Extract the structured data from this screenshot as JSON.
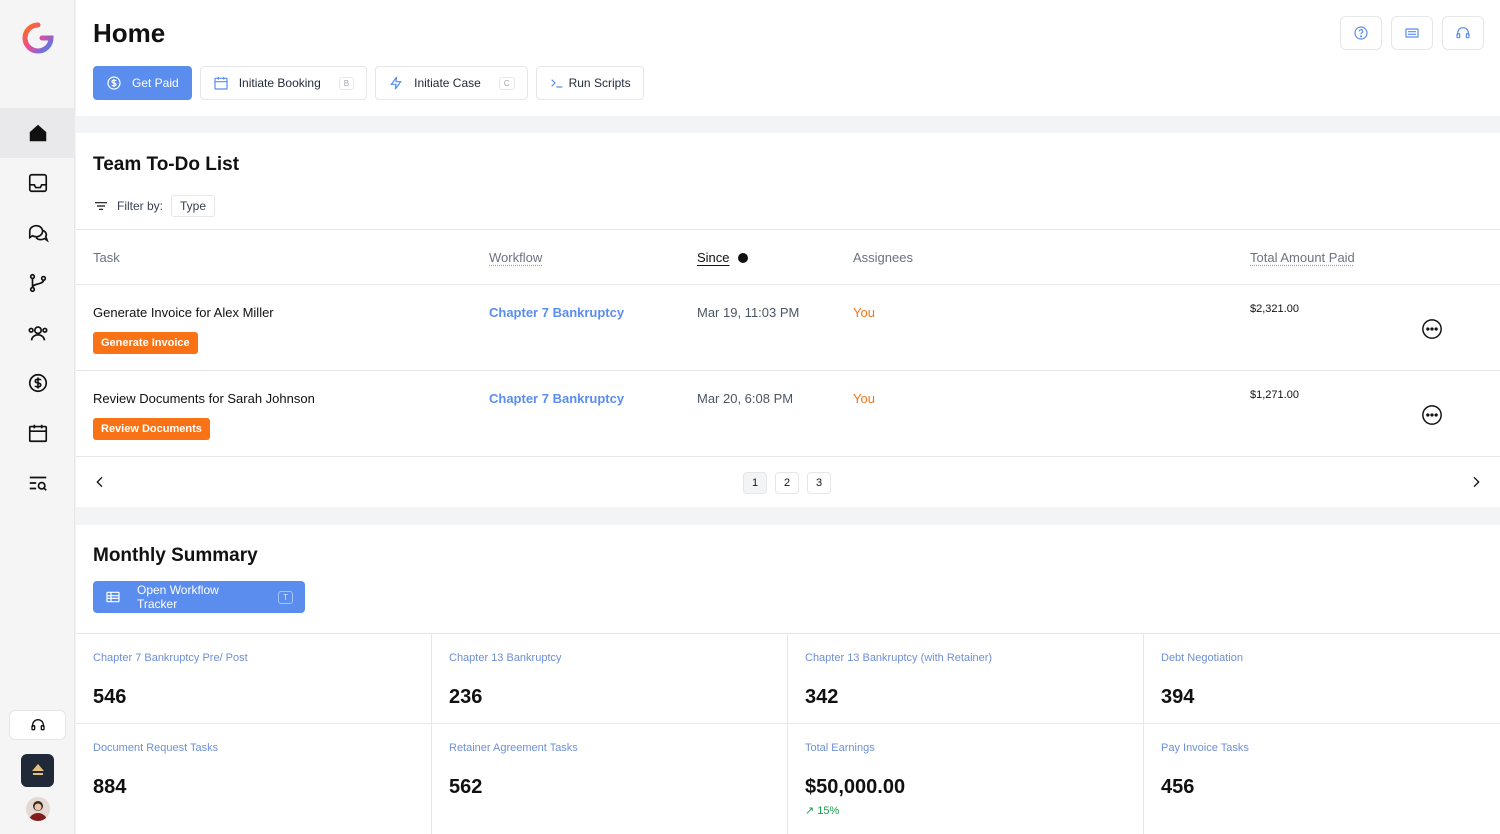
{
  "header": {
    "title": "Home",
    "actions": [
      {
        "label": "Get Paid",
        "shortcut": ""
      },
      {
        "label": "Initiate Booking",
        "shortcut": "B"
      },
      {
        "label": "Initiate Case",
        "shortcut": "C"
      },
      {
        "label": "Run Scripts",
        "shortcut": ""
      }
    ]
  },
  "todo": {
    "title": "Team To-Do List",
    "filter_label": "Filter by:",
    "filter_value": "Type",
    "columns": {
      "task": "Task",
      "workflow": "Workflow",
      "since": "Since",
      "assignees": "Assignees",
      "amount": "Total Amount Paid"
    },
    "rows": [
      {
        "task": "Generate Invoice for Alex Miller",
        "action": "Generate Invoice",
        "workflow": "Chapter 7 Bankruptcy",
        "since": "Mar 19, 11:03 PM",
        "assignee": "You",
        "amount": "$2,321.00"
      },
      {
        "task": "Review Documents for Sarah Johnson",
        "action": "Review Documents",
        "workflow": "Chapter 7 Bankruptcy",
        "since": "Mar 20, 6:08 PM",
        "assignee": "You",
        "amount": "$1,271.00"
      }
    ],
    "pages": [
      "1",
      "2",
      "3"
    ],
    "current_page": "1"
  },
  "summary": {
    "title": "Monthly Summary",
    "tracker_button": "Open Workflow Tracker",
    "tracker_shortcut": "T",
    "stats": [
      {
        "label": "Chapter 7 Bankruptcy Pre/ Post",
        "value": "546"
      },
      {
        "label": "Chapter 13 Bankruptcy",
        "value": "236"
      },
      {
        "label": "Chapter 13 Bankruptcy (with Retainer)",
        "value": "342"
      },
      {
        "label": "Debt Negotiation",
        "value": "394"
      },
      {
        "label": "Document Request Tasks",
        "value": "884"
      },
      {
        "label": "Retainer Agreement Tasks",
        "value": "562"
      },
      {
        "label": "Total Earnings",
        "value": "$50,000.00",
        "trend": "15%"
      },
      {
        "label": "Pay Invoice Tasks",
        "value": "456"
      }
    ]
  },
  "colors": {
    "primary": "#5b8def",
    "accent": "#f97316",
    "trend_up": "#16a34a"
  }
}
